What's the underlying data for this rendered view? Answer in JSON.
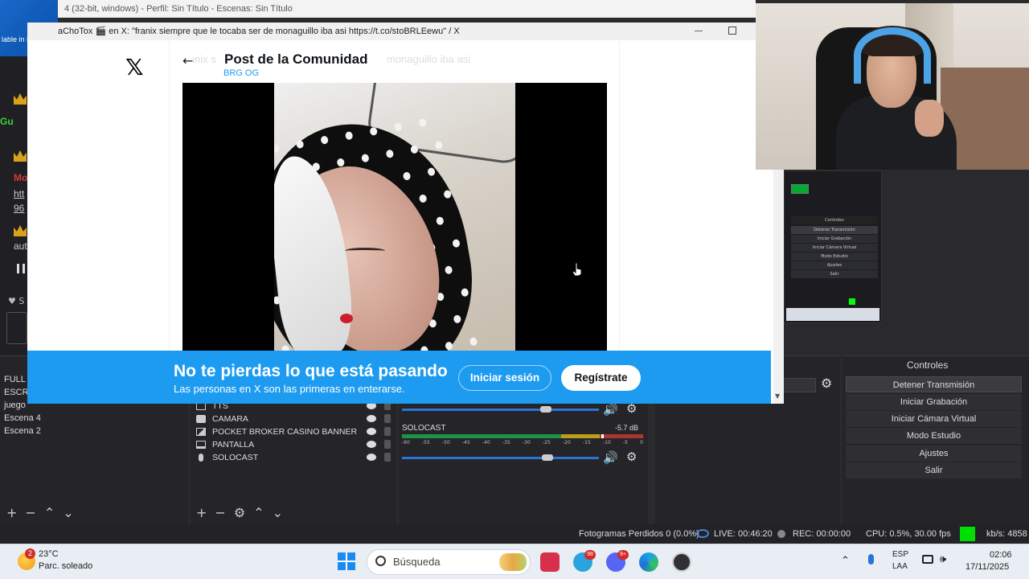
{
  "obs": {
    "title": "4 (32-bit, windows) - Perfil: Sin Título - Escenas: Sin Título",
    "brazil_badge": "lable in Brazil",
    "chat_letters": [
      "Gu",
      "Mo",
      "htt",
      "96",
      "aut"
    ],
    "left_symbol_s": "S",
    "scenes": [
      "FULL",
      "ESCRI",
      "juego",
      "Escena 4",
      "Escena 2"
    ],
    "sources": [
      "TTS",
      "CAMARA",
      "POCKET BROKER CASINO BANNER",
      "PANTALLA",
      "SOLOCAST"
    ],
    "audio": {
      "name": "SOLOCAST",
      "db": "-5.7 dB",
      "ticks": [
        "-60",
        "-55",
        "-50",
        "-45",
        "-40",
        "-35",
        "-30",
        "-25",
        "-20",
        "-15",
        "-10",
        "-5",
        "0"
      ]
    },
    "controls_title": "Controles",
    "controls": [
      "Detener Transmisión",
      "Iniciar Grabación",
      "Iniciar Cámara Virtual",
      "Modo Estudio",
      "Ajustes",
      "Salir"
    ],
    "mini_controls": [
      "Controles",
      "Detener Transmisión",
      "Iniciar Grabación",
      "Iniciar Cámara Virtual",
      "Modo Estudio",
      "Ajustes",
      "Salir"
    ],
    "status": {
      "dropped": "Fotogramas Perdidos 0 (0.0%)",
      "live": "LIVE: 00:46:20",
      "rec": "REC: 00:00:00",
      "cpu": "CPU: 0.5%, 30.00 fps",
      "kbs": "kb/s: 4858"
    }
  },
  "browser": {
    "title": "aChoTox 🎬 en X: \"franix siempre que le tocaba ser de monaguillo iba asi https://t.co/stoBRLEewu\" / X",
    "ghost_text_left": "Fanix s",
    "ghost_text_right": "monaguillo iba asi",
    "logo": "𝕏",
    "post_header": "Post de la Comunidad",
    "handle": "BRG OG",
    "banner": {
      "title": "No te pierdas lo que está pasando",
      "subtitle": "Las personas en X son las primeras en enterarse.",
      "login": "Iniciar sesión",
      "signup": "Regístrate"
    }
  },
  "taskbar": {
    "weather_temp": "23°C",
    "weather_desc": "Parc. soleado",
    "weather_badge": "2",
    "search_placeholder": "Búsqueda",
    "lang_top": "ESP",
    "lang_bottom": "LAA",
    "time": "02:06",
    "date": "17/11/2025",
    "telegram_badge": "98",
    "discord_badge": "9+"
  },
  "colors": {
    "x_blue": "#1d9bf0",
    "obs_bg": "#252529",
    "live_green": "#00e000"
  }
}
